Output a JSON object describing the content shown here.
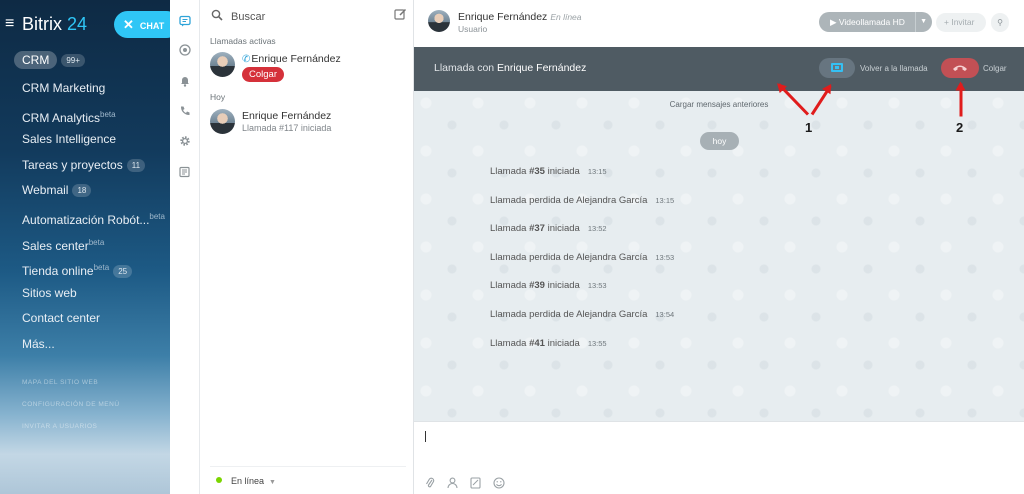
{
  "app": {
    "brand": "Bitrix",
    "brand_number": "24",
    "chat_button": "CHAT"
  },
  "left_menu": {
    "crm_label": "CRM",
    "crm_count": "99+",
    "items": [
      {
        "label": "CRM Marketing",
        "sup": "",
        "count": ""
      },
      {
        "label": "CRM Analytics",
        "sup": "beta",
        "count": ""
      },
      {
        "label": "Sales Intelligence",
        "sup": "",
        "count": ""
      },
      {
        "label": "Tareas y proyectos",
        "sup": "",
        "count": "11"
      },
      {
        "label": "Webmail",
        "sup": "",
        "count": "18"
      },
      {
        "label": "Automatización Robót...",
        "sup": "beta",
        "count": ""
      },
      {
        "label": "Sales center",
        "sup": "beta",
        "count": ""
      },
      {
        "label": "Tienda online",
        "sup": "beta",
        "count": "25"
      },
      {
        "label": "Sitios web",
        "sup": "",
        "count": ""
      },
      {
        "label": "Contact center",
        "sup": "",
        "count": ""
      },
      {
        "label": "Más...",
        "sup": "",
        "count": ""
      }
    ],
    "small_links": [
      "MAPA DEL SITIO WEB",
      "CONFIGURACIÓN DE MENÚ",
      "INVITAR A USUARIOS"
    ]
  },
  "recent": {
    "search_placeholder": "Buscar",
    "active_calls_header": "Llamadas activas",
    "active_call": {
      "name": "Enrique Fernández",
      "hangup_label": "Colgar"
    },
    "today_header": "Hoy",
    "today_item": {
      "name": "Enrique Fernández",
      "subtitle": "Llamada #117 iniciada"
    },
    "status": "En línea"
  },
  "chat_header": {
    "name": "Enrique Fernández",
    "status": "En línea",
    "role": "Usuario",
    "video_call_label": "Videollamada HD",
    "invite_label": "Invitar"
  },
  "call_bar": {
    "prefix": "Llamada con",
    "name": "Enrique Fernández",
    "return_label": "Volver a la llamada",
    "hangup_label": "Colgar"
  },
  "messages": {
    "load_older": "Cargar mensajes anteriores",
    "date_badge": "hoy",
    "items": [
      {
        "pre": "Llamada ",
        "num": "#35",
        "post": " iniciada",
        "time": "13:15"
      },
      {
        "pre": "Llamada perdida de Alejandra García",
        "num": "",
        "post": "",
        "time": "13:15"
      },
      {
        "pre": "Llamada ",
        "num": "#37",
        "post": " iniciada",
        "time": "13:52"
      },
      {
        "pre": "Llamada perdida de Alejandra García",
        "num": "",
        "post": "",
        "time": "13:53"
      },
      {
        "pre": "Llamada ",
        "num": "#39",
        "post": " iniciada",
        "time": "13:53"
      },
      {
        "pre": "Llamada perdida de Alejandra García",
        "num": "",
        "post": "",
        "time": "13:54"
      },
      {
        "pre": "Llamada ",
        "num": "#41",
        "post": " iniciada",
        "time": "13:55"
      }
    ]
  },
  "annotations": {
    "label_1": "1",
    "label_2": "2"
  },
  "colors": {
    "accent": "#2fc6f6",
    "danger": "#d5313a",
    "callbar": "#4f5b63",
    "annotation": "#e01c1c"
  },
  "icons": [
    "menu-icon",
    "close-icon",
    "chat-icon",
    "channel-icon",
    "notifications-icon",
    "phone-icon",
    "settings-icon",
    "news-icon",
    "search-icon",
    "new-chat-icon",
    "video-icon",
    "plus-icon",
    "chat-search-icon",
    "screen-share-icon",
    "hangup-icon",
    "attach-icon",
    "contact-icon",
    "file-icon",
    "smile-icon"
  ]
}
